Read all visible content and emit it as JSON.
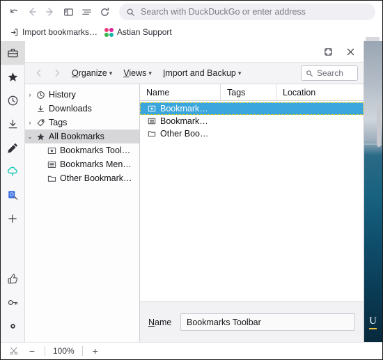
{
  "browser": {
    "nav_buttons": [
      {
        "name": "undo-icon",
        "label": "Undo"
      },
      {
        "name": "back-icon",
        "label": "Back"
      },
      {
        "name": "forward-icon",
        "label": "Forward"
      },
      {
        "name": "sidebar-toggle-icon",
        "label": "Toggle sidebar"
      },
      {
        "name": "reader-view-icon",
        "label": "Reader view"
      },
      {
        "name": "reload-icon",
        "label": "Reload"
      }
    ],
    "urlbar": {
      "placeholder": "Search with DuckDuckGo or enter address",
      "icon": "search-icon"
    },
    "bookmarks_bar": [
      {
        "label": "Import bookmarks…",
        "icon": "import-bookmarks-icon"
      },
      {
        "label": "Astian Support",
        "icon": "astian-dots-icon"
      }
    ],
    "astian_dot_colors": [
      "#ef3d7a",
      "#e0219b",
      "#3cb54a",
      "#16b3a7"
    ]
  },
  "sidebar": {
    "items": [
      {
        "name": "sidebar-item-toolbox",
        "icon": "briefcase-icon",
        "label": "Tools",
        "active": true
      },
      {
        "name": "sidebar-item-bookmarks",
        "icon": "star-icon",
        "label": "Bookmarks",
        "active": false
      },
      {
        "name": "sidebar-item-history",
        "icon": "clock-icon",
        "label": "History",
        "active": false
      },
      {
        "name": "sidebar-item-downloads",
        "icon": "download-icon",
        "label": "Downloads",
        "active": false
      },
      {
        "name": "sidebar-item-notes",
        "icon": "pencil-icon",
        "label": "Notes",
        "active": false
      },
      {
        "name": "sidebar-item-cloud",
        "icon": "cloud-icon",
        "label": "Cloud",
        "active": false
      },
      {
        "name": "sidebar-item-translate",
        "icon": "translate-doc-icon",
        "label": "Translate",
        "active": false
      },
      {
        "name": "sidebar-item-add",
        "icon": "plus-icon",
        "label": "Add",
        "active": false
      }
    ],
    "bottom_items": [
      {
        "name": "sidebar-item-feedback",
        "icon": "thumbs-up-icon",
        "label": "Feedback"
      },
      {
        "name": "sidebar-item-passwords",
        "icon": "key-icon",
        "label": "Passwords"
      },
      {
        "name": "sidebar-item-settings",
        "icon": "gear-icon",
        "label": "Settings"
      }
    ],
    "accent_cloud": "#1fc8b8",
    "accent_translate": "#3a6fe0"
  },
  "library": {
    "titlebar": {
      "restore_label": "Restore",
      "close_label": "Close"
    },
    "toolbar": {
      "back_label": "Back",
      "forward_label": "Forward",
      "menus": [
        {
          "name": "organize-menu",
          "pre": "",
          "accel": "O",
          "post": "rganize"
        },
        {
          "name": "views-menu",
          "pre": "",
          "accel": "V",
          "post": "iews"
        },
        {
          "name": "import-backup-menu",
          "pre": "",
          "accel": "I",
          "post": "mport and Backup"
        }
      ],
      "search_placeholder": "Search"
    },
    "tree": [
      {
        "name": "tree-item-history",
        "twisty": "›",
        "icon": "clock-icon",
        "label": "History",
        "indent": 0,
        "selected": false
      },
      {
        "name": "tree-item-downloads",
        "twisty": "",
        "icon": "download-icon",
        "label": "Downloads",
        "indent": 0,
        "selected": false
      },
      {
        "name": "tree-item-tags",
        "twisty": "›",
        "icon": "tag-icon",
        "label": "Tags",
        "indent": 0,
        "selected": false
      },
      {
        "name": "tree-item-all-bookmarks",
        "twisty": "⌄",
        "icon": "star-icon",
        "label": "All Bookmarks",
        "indent": 0,
        "selected": true
      },
      {
        "name": "tree-item-bookmarks-toolbar",
        "twisty": "",
        "icon": "toolbar-folder-icon",
        "label": "Bookmarks Tool…",
        "indent": 1,
        "selected": false
      },
      {
        "name": "tree-item-bookmarks-menu",
        "twisty": "",
        "icon": "menu-folder-icon",
        "label": "Bookmarks Men…",
        "indent": 1,
        "selected": false
      },
      {
        "name": "tree-item-other-bookmarks",
        "twisty": "",
        "icon": "folder-icon",
        "label": "Other Bookmark…",
        "indent": 1,
        "selected": false
      }
    ],
    "columns": [
      {
        "name": "column-header-name",
        "label": "Name"
      },
      {
        "name": "column-header-tags",
        "label": "Tags"
      },
      {
        "name": "column-header-location",
        "label": "Location"
      }
    ],
    "rows": [
      {
        "name": "list-row-bookmarks-toolbar",
        "icon": "toolbar-folder-icon",
        "label": "Bookmark…",
        "tags": "",
        "location": "",
        "selected": true
      },
      {
        "name": "list-row-bookmarks-menu",
        "icon": "menu-folder-icon",
        "label": "Bookmark…",
        "tags": "",
        "location": "",
        "selected": false
      },
      {
        "name": "list-row-other-bookmarks",
        "icon": "folder-icon",
        "label": "Other Boo…",
        "tags": "",
        "location": "",
        "selected": false
      }
    ],
    "detail": {
      "name_label_accel": "N",
      "name_label_rest": "ame",
      "name_value": "Bookmarks Toolbar"
    },
    "selection_color": "#3aa6dd"
  },
  "statusbar": {
    "capture_icon": "scissors-icon",
    "zoom_out_label": "−",
    "zoom_level": "100%",
    "zoom_in_label": "+"
  },
  "page": {
    "watermark": "U"
  }
}
